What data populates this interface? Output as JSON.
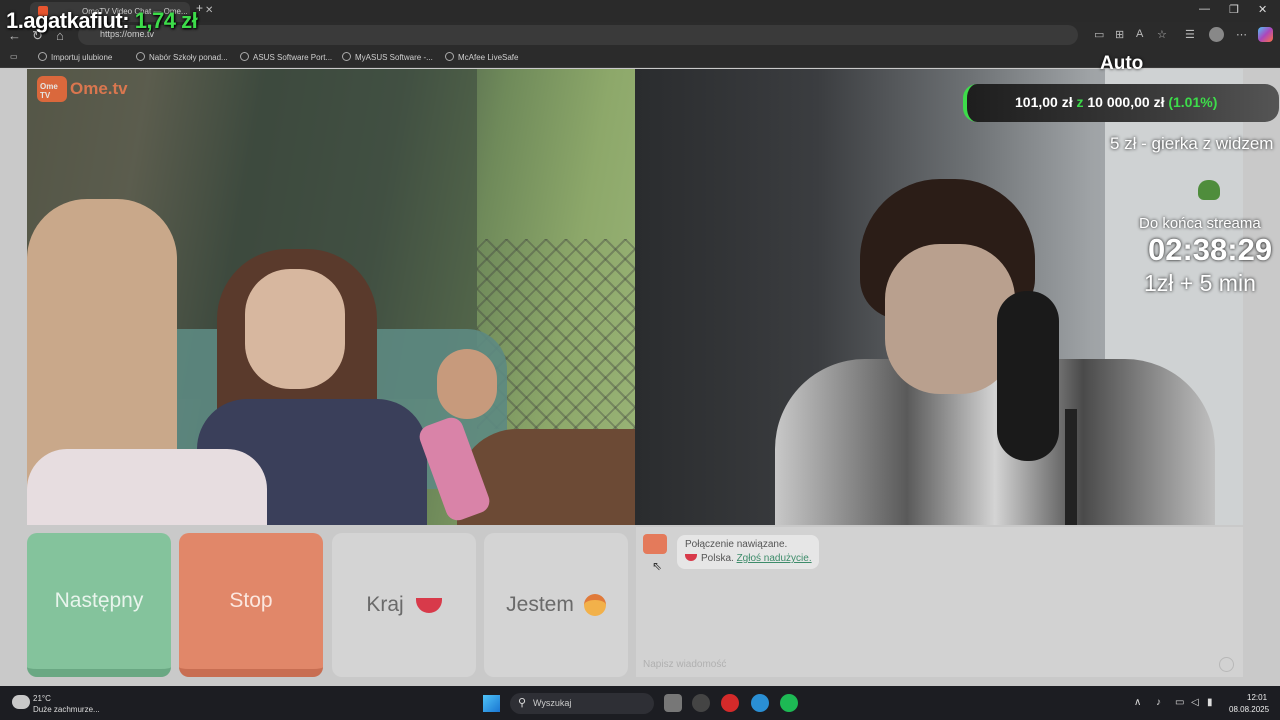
{
  "browser": {
    "tab_title": "OmeTV Video Chat — Ome...",
    "url": "https://ome.tv",
    "bookmarks": [
      "Importuj ulubione",
      "Nabór Szkoły ponad...",
      "ASUS Software Port...",
      "MyASUS Software -...",
      "McAfee LiveSafe"
    ]
  },
  "site": {
    "logo_icon_text": "Ome TV",
    "logo_text": "Ome.tv"
  },
  "controls": {
    "next_label": "Następny",
    "stop_label": "Stop",
    "country_label": "Kraj",
    "gender_label": "Jestem"
  },
  "chat": {
    "message_line1": "Połączenie nawiązane.",
    "country": "Polska.",
    "report_link": "Zgłoś nadużycie.",
    "input_placeholder": "Napisz wiadomość"
  },
  "overlay": {
    "top_donor_name": "1.agatkafiut:",
    "top_donor_amount": "1,74 zł",
    "mode": "Auto",
    "goal_current": "101,00 zł",
    "goal_sep": "z",
    "goal_target": "10 000,00 zł",
    "goal_percent": "(1.01%)",
    "game_text": "5 zł - gierka z widzem",
    "end_label": "Do końca streama",
    "timer": "02:38:29",
    "rate_text": "1zł + 5 min"
  },
  "taskbar": {
    "temperature": "21°C",
    "weather_desc": "Duże zachmurze...",
    "search_placeholder": "Wyszukaj",
    "time": "12:01",
    "date": "08.08.2025"
  },
  "colors": {
    "accent_green": "#3ddc4a",
    "next_button": "#84c39c",
    "stop_button": "#e18769",
    "ome_orange": "#f26b3a"
  }
}
